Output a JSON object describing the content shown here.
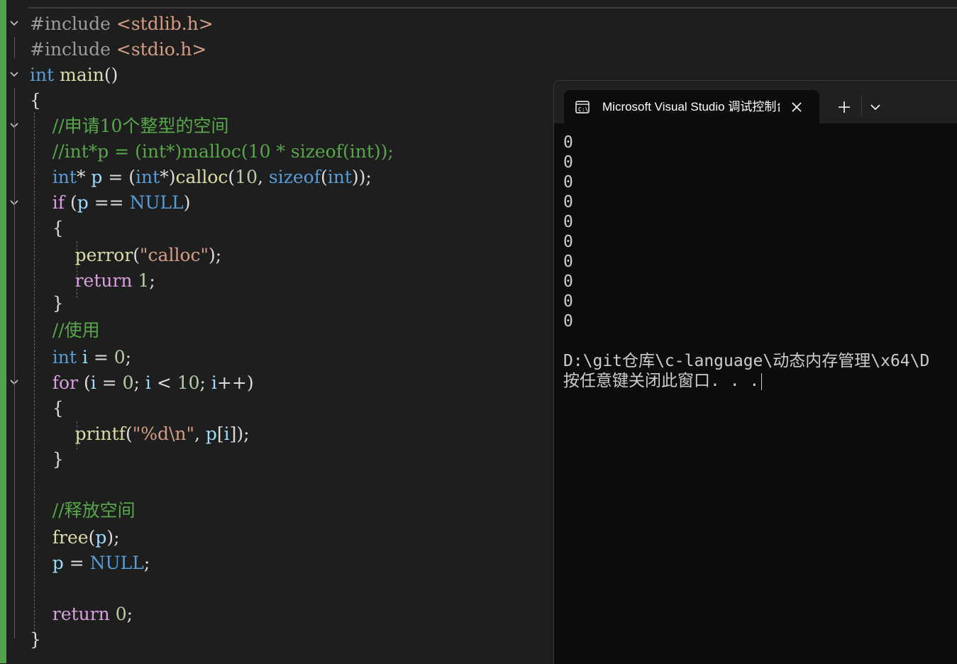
{
  "editor": {
    "lines": [
      {
        "id": "line-include-stdlib",
        "tokens": [
          {
            "t": "#include ",
            "c": "pre"
          },
          {
            "t": "<stdlib.h>",
            "c": "inc"
          }
        ]
      },
      {
        "id": "line-include-stdio",
        "tokens": [
          {
            "t": "#include ",
            "c": "pre"
          },
          {
            "t": "<stdio.h>",
            "c": "inc"
          }
        ]
      },
      {
        "id": "line-main-signature",
        "tokens": [
          {
            "t": "int",
            "c": "kw"
          },
          {
            "t": " "
          },
          {
            "t": "main",
            "c": "fn"
          },
          {
            "t": "()"
          }
        ]
      },
      {
        "id": "line-open-brace-main",
        "tokens": [
          {
            "t": "{"
          }
        ]
      },
      {
        "id": "line-comment-apply",
        "tokens": [
          {
            "t": "    "
          },
          {
            "t": "//申请10个整型的空间",
            "c": "cm"
          }
        ]
      },
      {
        "id": "line-comment-malloc",
        "tokens": [
          {
            "t": "    "
          },
          {
            "t": "//int*p = (int*)malloc(10 * sizeof(int));",
            "c": "cm"
          }
        ]
      },
      {
        "id": "line-calloc",
        "tokens": [
          {
            "t": "    "
          },
          {
            "t": "int",
            "c": "kw"
          },
          {
            "t": "* "
          },
          {
            "t": "p",
            "c": "var"
          },
          {
            "t": " = ("
          },
          {
            "t": "int",
            "c": "kw"
          },
          {
            "t": "*)"
          },
          {
            "t": "calloc",
            "c": "fn"
          },
          {
            "t": "("
          },
          {
            "t": "10",
            "c": "num"
          },
          {
            "t": ", "
          },
          {
            "t": "sizeof",
            "c": "kw"
          },
          {
            "t": "("
          },
          {
            "t": "int",
            "c": "kw"
          },
          {
            "t": "));"
          }
        ]
      },
      {
        "id": "line-if-null",
        "tokens": [
          {
            "t": "    "
          },
          {
            "t": "if",
            "c": "kw2"
          },
          {
            "t": " ("
          },
          {
            "t": "p",
            "c": "var"
          },
          {
            "t": " == "
          },
          {
            "t": "NULL",
            "c": "kw"
          },
          {
            "t": ")"
          }
        ]
      },
      {
        "id": "line-open-brace-if",
        "tokens": [
          {
            "t": "    {"
          }
        ]
      },
      {
        "id": "line-perror",
        "tokens": [
          {
            "t": "        "
          },
          {
            "t": "perror",
            "c": "fn"
          },
          {
            "t": "("
          },
          {
            "t": "\"calloc\"",
            "c": "str"
          },
          {
            "t": ");"
          }
        ]
      },
      {
        "id": "line-return-1",
        "tokens": [
          {
            "t": "        "
          },
          {
            "t": "return",
            "c": "kw2"
          },
          {
            "t": " "
          },
          {
            "t": "1",
            "c": "num"
          },
          {
            "t": ";"
          }
        ]
      },
      {
        "id": "line-close-brace-if",
        "tokens": [
          {
            "t": "    }"
          }
        ]
      },
      {
        "id": "line-comment-use",
        "tokens": [
          {
            "t": "    "
          },
          {
            "t": "//使用",
            "c": "cm"
          }
        ]
      },
      {
        "id": "line-int-i",
        "tokens": [
          {
            "t": "    "
          },
          {
            "t": "int",
            "c": "kw"
          },
          {
            "t": " "
          },
          {
            "t": "i",
            "c": "var"
          },
          {
            "t": " = "
          },
          {
            "t": "0",
            "c": "num"
          },
          {
            "t": ";"
          }
        ]
      },
      {
        "id": "line-for",
        "tokens": [
          {
            "t": "    "
          },
          {
            "t": "for",
            "c": "kw2"
          },
          {
            "t": " ("
          },
          {
            "t": "i",
            "c": "var"
          },
          {
            "t": " = "
          },
          {
            "t": "0",
            "c": "num"
          },
          {
            "t": "; "
          },
          {
            "t": "i",
            "c": "var"
          },
          {
            "t": " < "
          },
          {
            "t": "10",
            "c": "num"
          },
          {
            "t": "; "
          },
          {
            "t": "i",
            "c": "var"
          },
          {
            "t": "++)"
          }
        ]
      },
      {
        "id": "line-open-brace-for",
        "tokens": [
          {
            "t": "    {"
          }
        ]
      },
      {
        "id": "line-printf",
        "tokens": [
          {
            "t": "        "
          },
          {
            "t": "printf",
            "c": "fn"
          },
          {
            "t": "("
          },
          {
            "t": "\"%d\\n\"",
            "c": "str"
          },
          {
            "t": ", "
          },
          {
            "t": "p",
            "c": "var"
          },
          {
            "t": "["
          },
          {
            "t": "i",
            "c": "var"
          },
          {
            "t": "]);"
          }
        ]
      },
      {
        "id": "line-close-brace-for",
        "tokens": [
          {
            "t": "    }"
          }
        ]
      },
      {
        "id": "line-blank-1",
        "tokens": [
          {
            "t": ""
          }
        ]
      },
      {
        "id": "line-comment-free",
        "tokens": [
          {
            "t": "    "
          },
          {
            "t": "//释放空间",
            "c": "cm"
          }
        ]
      },
      {
        "id": "line-free",
        "tokens": [
          {
            "t": "    "
          },
          {
            "t": "free",
            "c": "fn"
          },
          {
            "t": "("
          },
          {
            "t": "p",
            "c": "var"
          },
          {
            "t": ");"
          }
        ]
      },
      {
        "id": "line-null-assign",
        "tokens": [
          {
            "t": "    "
          },
          {
            "t": "p",
            "c": "var"
          },
          {
            "t": " = "
          },
          {
            "t": "NULL",
            "c": "kw"
          },
          {
            "t": ";"
          }
        ]
      },
      {
        "id": "line-blank-2",
        "tokens": [
          {
            "t": ""
          }
        ]
      },
      {
        "id": "line-return-0",
        "tokens": [
          {
            "t": "    "
          },
          {
            "t": "return",
            "c": "kw2"
          },
          {
            "t": " "
          },
          {
            "t": "0",
            "c": "num"
          },
          {
            "t": ";"
          }
        ]
      },
      {
        "id": "line-close-brace-main",
        "tokens": [
          {
            "t": "}"
          }
        ]
      }
    ]
  },
  "console": {
    "tab_title": "Microsoft Visual Studio 调试控制台",
    "tab_icon": "terminal-icon",
    "close_icon": "close-icon",
    "new_tab_icon": "plus-icon",
    "dropdown_icon": "chevron-down-icon",
    "output_lines": [
      "0",
      "0",
      "0",
      "0",
      "0",
      "0",
      "0",
      "0",
      "0",
      "0",
      "",
      "D:\\git仓库\\c-language\\动态内存管理\\x64\\D",
      "按任意键关闭此窗口. . ."
    ]
  },
  "colors": {
    "editor_bg": "#1e1e1e",
    "change_bar": "#4ea34c",
    "keyword": "#569cd6",
    "control_keyword": "#d8a0df",
    "function": "#dcdcaa",
    "variable": "#9cdcfe",
    "comment": "#57a64a",
    "string": "#d69d85",
    "number": "#b5cea8",
    "console_bg": "#0c0c0c",
    "console_text": "#cccccc"
  }
}
